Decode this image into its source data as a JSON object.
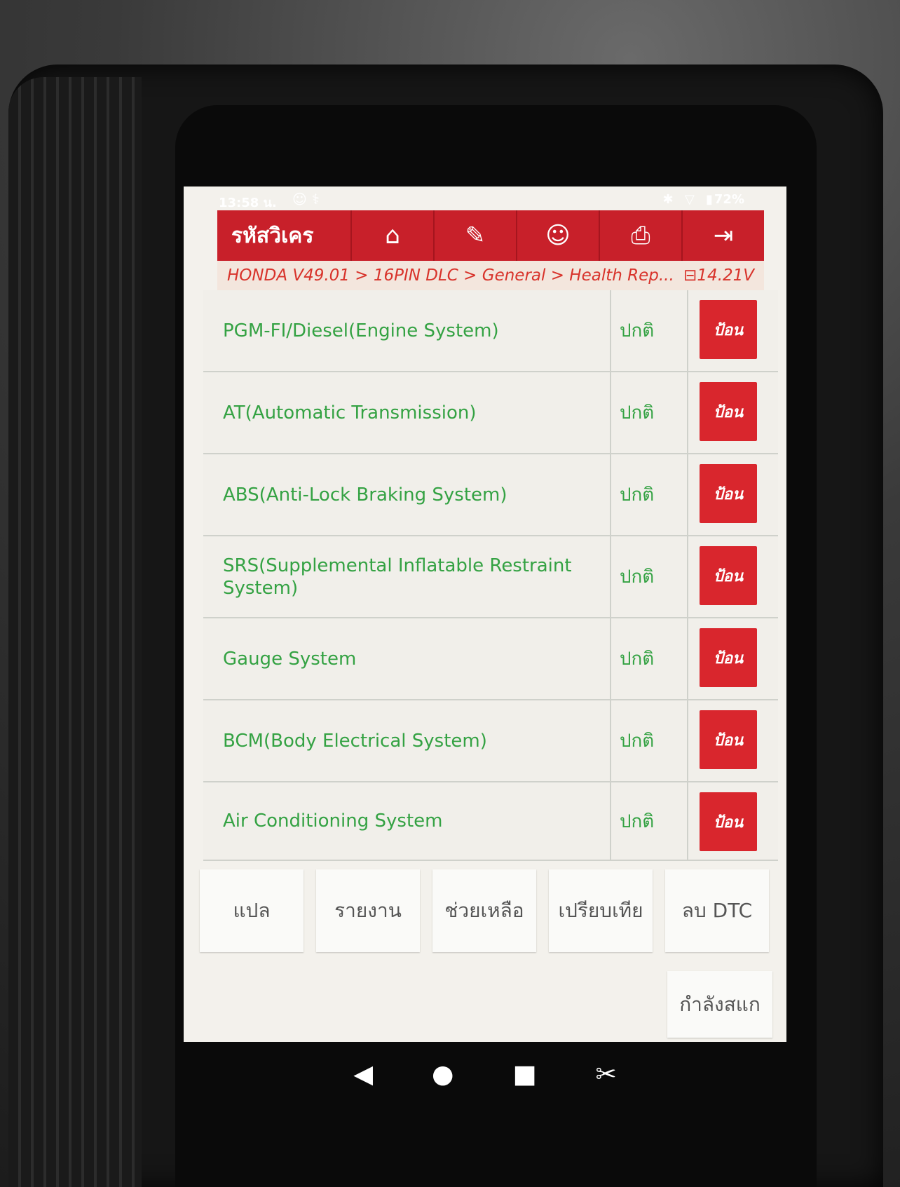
{
  "status_bar": {
    "time": "13:58 น.",
    "battery": "72%",
    "icons_left": [
      "face-icon",
      "stethoscope-icon"
    ],
    "icons_right": [
      "bluetooth-icon",
      "wifi-icon",
      "battery-icon"
    ]
  },
  "header": {
    "title": "รหัสวิเคร",
    "buttons": [
      {
        "name": "home-icon",
        "glyph": "⌂"
      },
      {
        "name": "edit-icon",
        "glyph": "✎"
      },
      {
        "name": "user-icon",
        "glyph": "☺"
      },
      {
        "name": "print-icon",
        "glyph": "⎙"
      },
      {
        "name": "exit-icon",
        "glyph": "⇥"
      }
    ]
  },
  "breadcrumb": {
    "path": "HONDA V49.01 > 16PIN DLC > General > Health Rep...",
    "voltage": "14.21V"
  },
  "systems": [
    {
      "name": "PGM-FI/Diesel(Engine System)",
      "status": "ปกติ",
      "action": "ป้อน"
    },
    {
      "name": "AT(Automatic Transmission)",
      "status": "ปกติ",
      "action": "ป้อน"
    },
    {
      "name": "ABS(Anti-Lock Braking System)",
      "status": "ปกติ",
      "action": "ป้อน"
    },
    {
      "name": "SRS(Supplemental Inflatable Restraint System)",
      "status": "ปกติ",
      "action": "ป้อน"
    },
    {
      "name": "Gauge System",
      "status": "ปกติ",
      "action": "ป้อน"
    },
    {
      "name": "BCM(Body Electrical System)",
      "status": "ปกติ",
      "action": "ป้อน"
    },
    {
      "name": "Air Conditioning System",
      "status": "ปกติ",
      "action": "ป้อน"
    }
  ],
  "actions": [
    "แปล",
    "รายงาน",
    "ช่วยเหลือ",
    "เปรียบเทีย",
    "ลบ DTC"
  ],
  "scan_button": "กำลังสแก",
  "navigation": [
    "back-icon",
    "home-icon",
    "recents-icon",
    "screenshot-icon"
  ],
  "colors": {
    "brand_red": "#c8202a",
    "ok_green": "#34a243"
  }
}
